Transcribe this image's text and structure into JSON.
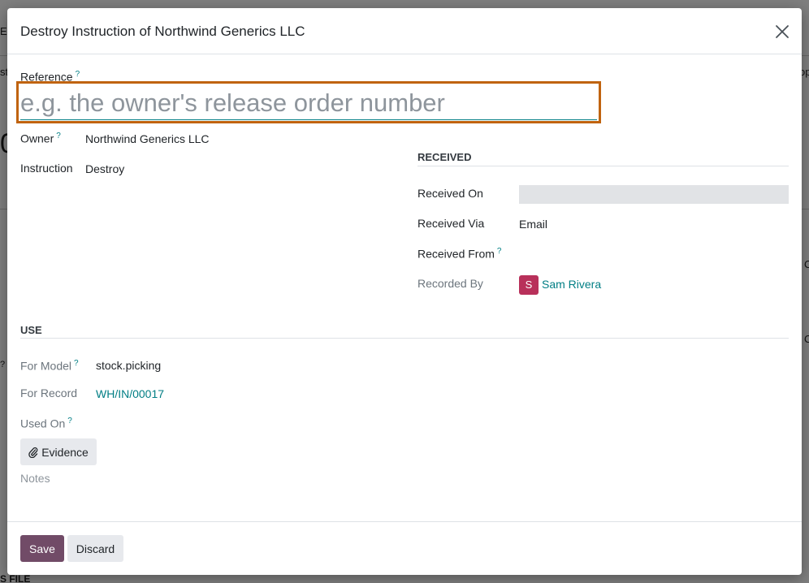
{
  "background": {
    "frag_top_left": "EN",
    "frag_left_row": "st",
    "frag_right_row": "op",
    "frag_big_left": "0",
    "frag_right_1": "C",
    "frag_right_2": "C",
    "frag_left_help": "?",
    "frag_bottom": "S FILE"
  },
  "dialog": {
    "title": "Destroy Instruction of Northwind Generics LLC",
    "close_icon": "close-icon"
  },
  "reference": {
    "label": "Reference",
    "help": "?",
    "value": "",
    "placeholder": "e.g. the owner's release order number"
  },
  "owner": {
    "label": "Owner",
    "help": "?",
    "value": "Northwind Generics LLC"
  },
  "instruction": {
    "label": "Instruction",
    "value": "Destroy"
  },
  "received": {
    "section_title": "RECEIVED",
    "received_on": {
      "label": "Received On",
      "value": ""
    },
    "received_via": {
      "label": "Received Via",
      "value": "Email"
    },
    "received_from": {
      "label": "Received From",
      "help": "?",
      "value": ""
    },
    "recorded_by": {
      "label": "Recorded By",
      "avatar_initial": "S",
      "avatar_color": "#b8305a",
      "value": "Sam Rivera"
    }
  },
  "use": {
    "section_title": "USE",
    "for_model": {
      "label": "For Model",
      "help": "?",
      "value": "stock.picking"
    },
    "for_record": {
      "label": "For Record",
      "value": "WH/IN/00017"
    },
    "used_on": {
      "label": "Used On",
      "help": "?",
      "value": ""
    }
  },
  "evidence_button": {
    "label": "Evidence",
    "icon": "paperclip-icon"
  },
  "notes": {
    "placeholder": "Notes"
  },
  "footer": {
    "save_label": "Save",
    "discard_label": "Discard"
  },
  "colors": {
    "primary": "#714b67",
    "link": "#017e84",
    "focus": "#c0630f"
  }
}
